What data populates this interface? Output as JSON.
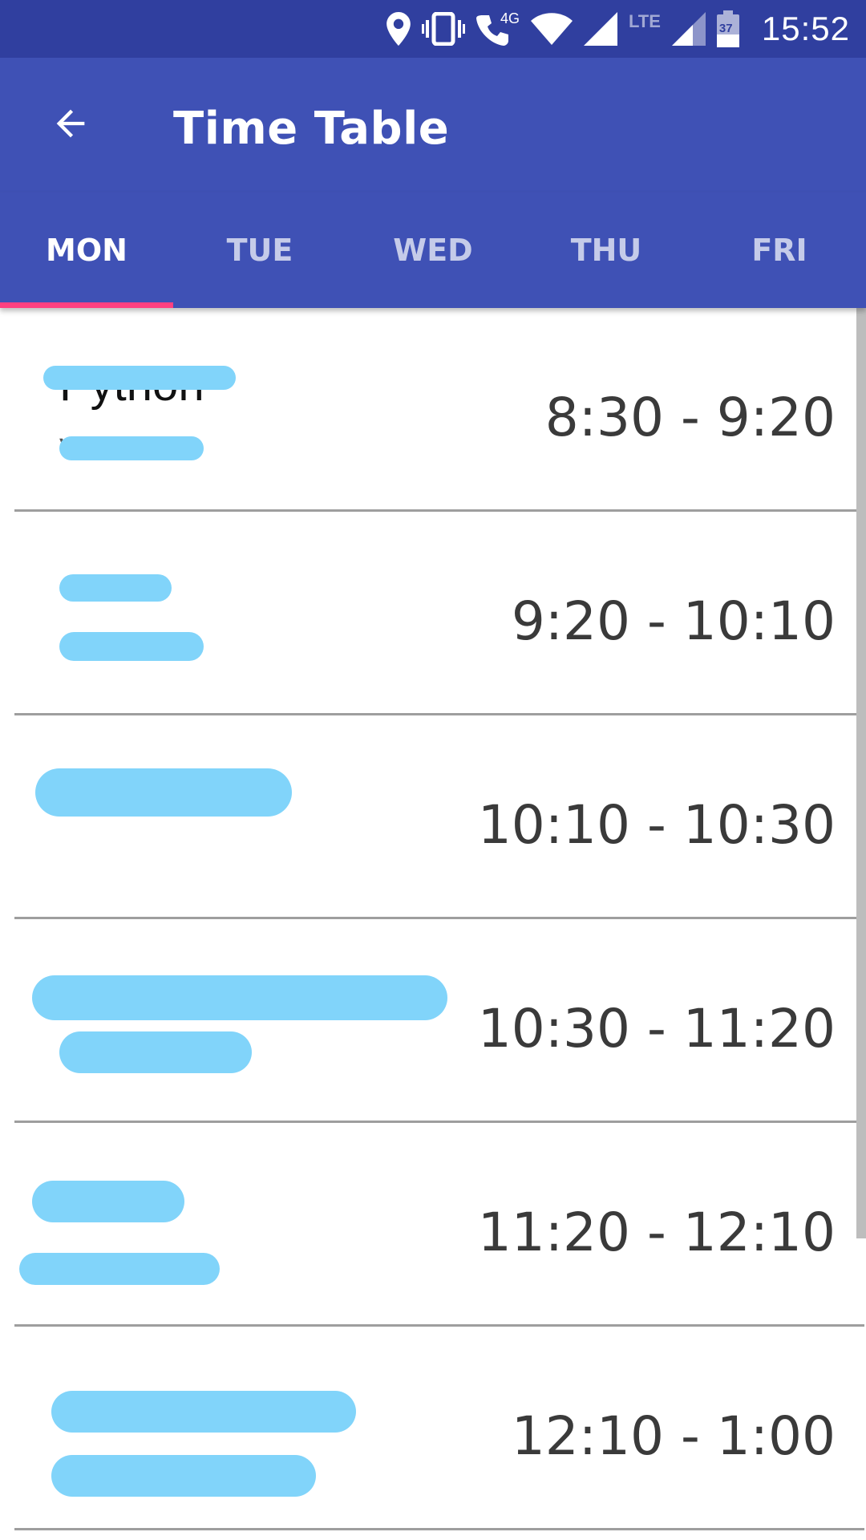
{
  "status_bar": {
    "time": "15:52",
    "network_label": "4G",
    "lte_label": "LTE",
    "battery_level": "37",
    "icons": [
      "location-icon",
      "vibrate-icon",
      "wifi-calling-icon",
      "wifi-icon",
      "signal-icon",
      "lte-signal-icon",
      "battery-icon"
    ]
  },
  "app_bar": {
    "title": "Time Table",
    "back_icon": "arrow-back-icon"
  },
  "tabs": [
    {
      "label": "MON",
      "active": true
    },
    {
      "label": "TUE",
      "active": false
    },
    {
      "label": "WED",
      "active": false
    },
    {
      "label": "THU",
      "active": false
    },
    {
      "label": "FRI",
      "active": false
    }
  ],
  "schedule": [
    {
      "subject": "Python",
      "teacher": "Vinutha",
      "time": "8:30 - 9:20"
    },
    {
      "subject": "",
      "teacher": "",
      "time": "9:20 - 10:10"
    },
    {
      "subject": "",
      "teacher": "",
      "time": "10:10 - 10:30"
    },
    {
      "subject": "",
      "teacher": "",
      "time": "10:30 - 11:20"
    },
    {
      "subject": "",
      "teacher": "",
      "time": "11:20 - 12:10"
    },
    {
      "subject": "",
      "teacher": "",
      "time": "12:10 - 1:00"
    }
  ],
  "colors": {
    "status_bar": "#303F9F",
    "app_bar": "#3F51B5",
    "tab_indicator": "#FF4081",
    "redaction": "#81D4FA"
  }
}
